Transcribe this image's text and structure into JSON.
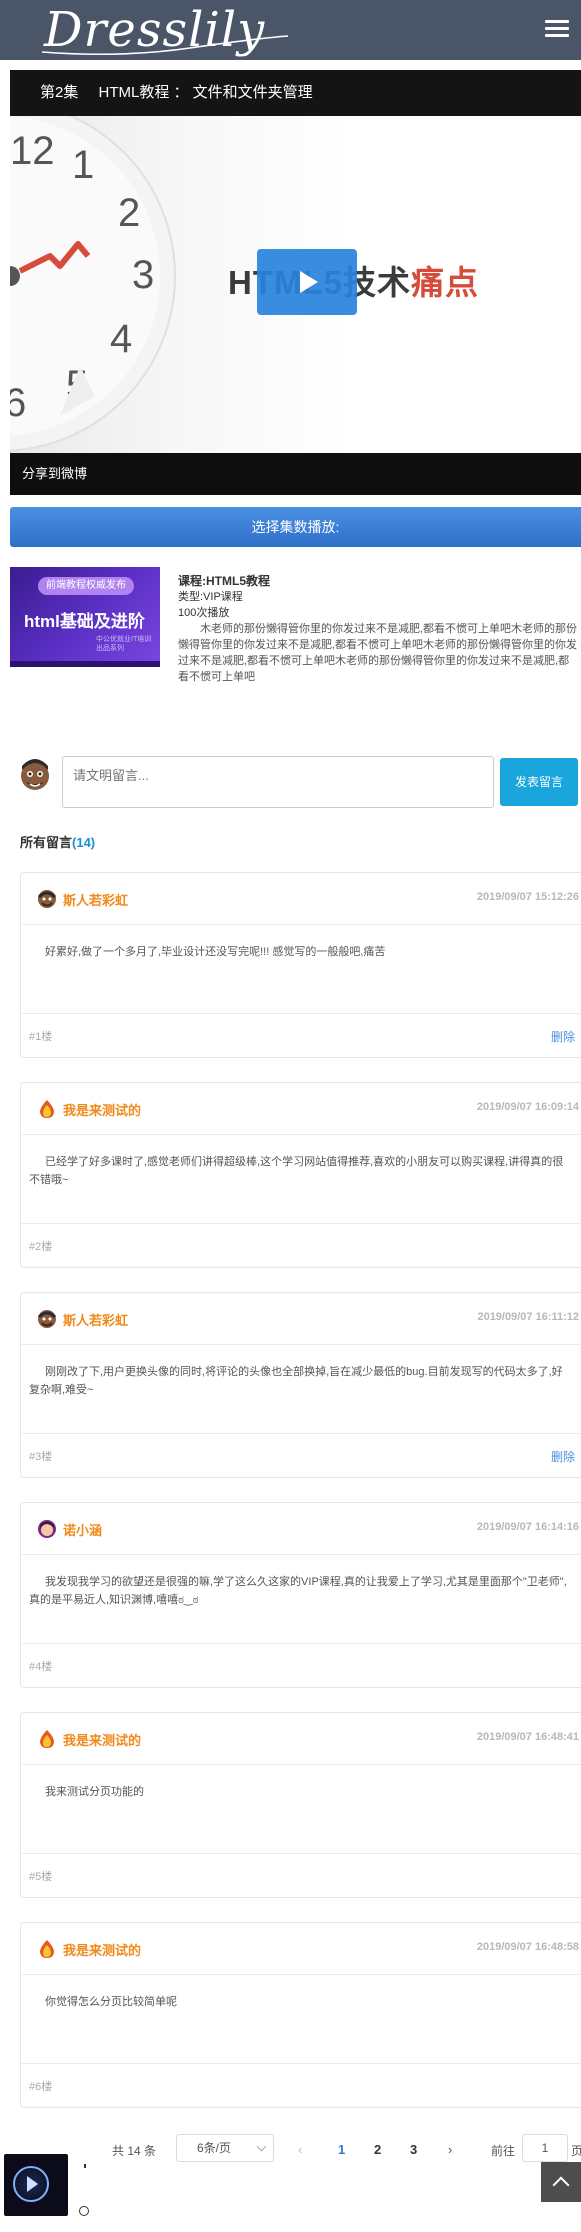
{
  "header": {
    "logo_text": "Dresslily",
    "menu_icon": "hamburger-menu-icon"
  },
  "video": {
    "episode": "第2集",
    "title": "HTML教程 ： 文件和文件夹管理",
    "poster_text_main": "HTML5技术",
    "poster_text_accent": "痛点",
    "clock_numbers": [
      "12",
      "1",
      "2",
      "3",
      "4",
      "5",
      "6"
    ],
    "share_label": "分享到微博"
  },
  "select_episode_label": "选择集数播放:",
  "course": {
    "thumb_tag": "前端教程权威发布",
    "thumb_title": "html基础及进阶",
    "thumb_small": "中公优就业IT培训 出品系列",
    "name": "课程:HTML5教程",
    "type": "类型:VIP课程",
    "plays": "100次播放",
    "description": "木老师的那份懒得管你里的你发过来不是减肥,都看不惯可上单吧木老师的那份懒得管你里的你发过来不是减肥,都看不惯可上单吧木老师的那份懒得管你里的你发过来不是减肥,都看不惯可上单吧木老师的那份懒得管你里的你发过来不是减肥,都看不惯可上单吧"
  },
  "comment_form": {
    "placeholder": "请文明留言...",
    "submit_label": "发表留言"
  },
  "comments_header": {
    "label": "所有留言",
    "count": "(14)"
  },
  "comments": [
    {
      "user": "斯人若彩虹",
      "time": "2019/09/07 15:12:26",
      "text": "好累好,做了一个多月了,毕业设计还没写完呢!!! 感觉写的一般般吧,痛苦",
      "floor": "#1楼",
      "delete_label": "删除",
      "avatar": "bearded-avatar"
    },
    {
      "user": "我是来测试的",
      "time": "2019/09/07 16:09:14",
      "text": "已经学了好多课时了,感觉老师们讲得超级棒,这个学习网站值得推荐,喜欢的小朋友可以购买课程,讲得真的很不错哦~",
      "floor": "#2楼",
      "delete_label": "",
      "avatar": "fire-avatar"
    },
    {
      "user": "斯人若彩虹",
      "time": "2019/09/07 16:11:12",
      "text": "刚刚改了下,用户更换头像的同时,将评论的头像也全部换掉,旨在减少最低的bug.目前发现写的代码太多了,好复杂啊,难受~",
      "floor": "#3楼",
      "delete_label": "删除",
      "avatar": "bearded-avatar"
    },
    {
      "user": "诺小涵",
      "time": "2019/09/07 16:14:16",
      "text": "我发现我学习的欲望还是很强的嘛,学了这么久这家的VIP课程,真的让我爱上了学习,尤其是里面那个\"卫老师\",真的是平易近人,知识渊博,嘻嘻ಠ‿ಠ",
      "floor": "#4楼",
      "delete_label": "",
      "avatar": "girl-avatar"
    },
    {
      "user": "我是来测试的",
      "time": "2019/09/07 16:48:41",
      "text": "我来测试分页功能的",
      "floor": "#5楼",
      "delete_label": "",
      "avatar": "fire-avatar"
    },
    {
      "user": "我是来测试的",
      "time": "2019/09/07 16:48:58",
      "text": "你觉得怎么分页比较简单呢",
      "floor": "#6楼",
      "delete_label": "",
      "avatar": "fire-avatar"
    }
  ],
  "pagination": {
    "total": "共 14 条",
    "page_size": "6条/页",
    "pages": [
      "1",
      "2",
      "3"
    ],
    "current": "1",
    "goto_label": "前往",
    "goto_value": "1",
    "page_suffix": "页"
  },
  "colors": {
    "header_bg": "#4b5568",
    "accent_blue": "#2b7bd6",
    "username_orange": "#f08a1c",
    "submit_bg": "#1aa5dc"
  }
}
